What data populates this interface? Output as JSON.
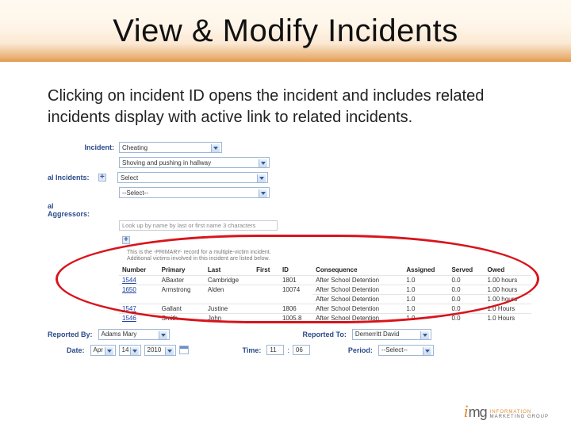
{
  "slide": {
    "title": "View & Modify Incidents",
    "description": "Clicking on incident ID opens the incident and includes related incidents display with active link to related incidents."
  },
  "form": {
    "incident_label": "Incident:",
    "incident_value": "Cheating",
    "incident_note": "Shoving and pushing in hallway",
    "additional_label": "al Incidents:",
    "additional_sel1": "Select",
    "additional_sel2": "--Select--",
    "aggressors_label": "al Aggressors:",
    "lookup_placeholder": "Look up by name by last or first name 3 characters",
    "primary_note_line1": "This is the -PRIMARY- record for a multiple-victim incident.",
    "primary_note_line2": "Additional victims involved in this incident are listed below."
  },
  "table": {
    "headers": [
      "Number",
      "Primary",
      "Last",
      "First",
      "ID",
      "Consequence",
      "Assigned",
      "Served",
      "Owed"
    ],
    "rows": [
      {
        "number": "1544",
        "primary": "ABaxter",
        "last": "Cambridge",
        "first": "",
        "id": "1801",
        "conseq": [
          "After School Detention"
        ],
        "assigned": [
          "1.0"
        ],
        "served": [
          "0.0"
        ],
        "owed": [
          "1.00 hours"
        ]
      },
      {
        "number": "1650",
        "primary": "Armstrong",
        "last": "Alden",
        "first": "",
        "id": "10074",
        "conseq": [
          "After School Detention",
          "After School Detention"
        ],
        "assigned": [
          "1.0",
          "1.0"
        ],
        "served": [
          "0.0",
          "0.0"
        ],
        "owed": [
          "1.00 hours",
          "1.00 hours"
        ]
      },
      {
        "number": "1547",
        "primary": "Gallant",
        "last": "Justine",
        "first": "",
        "id": "1806",
        "conseq": [
          "After School Detention"
        ],
        "assigned": [
          "1.0"
        ],
        "served": [
          "0.0"
        ],
        "owed": [
          "1.0 Hours"
        ]
      },
      {
        "number": "1546",
        "primary": "Smith",
        "last": "John",
        "first": "",
        "id": "1005.8",
        "conseq": [
          "After School Detention"
        ],
        "assigned": [
          "1.0"
        ],
        "served": [
          "0.0"
        ],
        "owed": [
          "1.0 Hours"
        ]
      }
    ]
  },
  "footer": {
    "reported_by_label": "Reported By:",
    "reported_by_value": "Adams Mary",
    "reported_to_label": "Reported To:",
    "reported_to_value": "Demerritt David",
    "date_label": "Date:",
    "date_month": "Apr",
    "date_day": "14",
    "date_year": "2010",
    "time_label": "Time:",
    "time_hr": "11",
    "time_min": "06",
    "period_label": "Period:",
    "period_value": "--Select--"
  },
  "logo": {
    "mark": "img",
    "line1": "INFORMATION",
    "line2": "MARKETING GROUP"
  }
}
